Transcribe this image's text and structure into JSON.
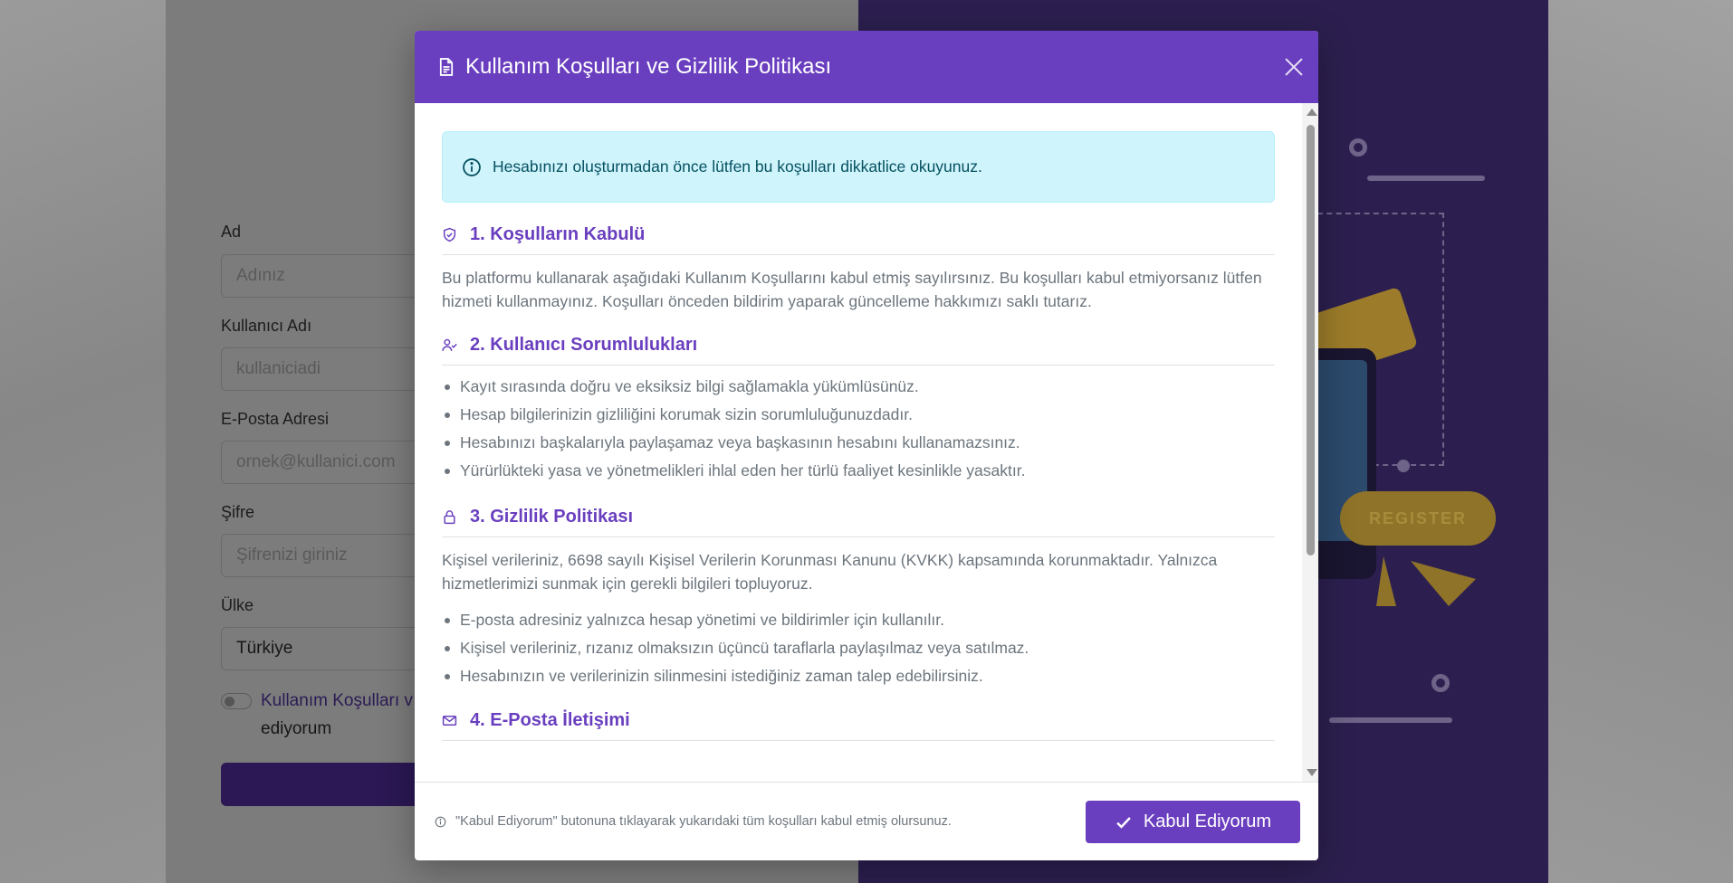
{
  "background": {
    "form": {
      "fields": [
        {
          "label": "Ad",
          "placeholder": "Adınız"
        },
        {
          "label": "Kullanıcı Adı",
          "placeholder": "kullaniciadi"
        },
        {
          "label": "E-Posta Adresi",
          "placeholder": "ornek@kullanici.com"
        },
        {
          "label": "Şifre",
          "placeholder": "Şifrenizi giriniz"
        },
        {
          "label": "Ülke",
          "value": "Türkiye"
        }
      ],
      "terms_link": "Kullanım Koşulları v",
      "terms_rest": "ediyorum"
    },
    "art": {
      "register_label": "REGISTER"
    }
  },
  "modal": {
    "title": "Kullanım Koşulları ve Gizlilik Politikası",
    "alert": "Hesabınızı oluşturmadan önce lütfen bu koşulları dikkatlice okuyunuz.",
    "sections": [
      {
        "title": "1. Koşulların Kabulü",
        "icon": "shield-check-icon",
        "paragraph": "Bu platformu kullanarak aşağıdaki Kullanım Koşullarını kabul etmiş sayılırsınız. Bu koşulları kabul etmiyorsanız lütfen hizmeti kullanmayınız. Koşulları önceden bildirim yaparak güncelleme hakkımızı saklı tutarız."
      },
      {
        "title": "2. Kullanıcı Sorumlulukları",
        "icon": "user-check-icon",
        "bullets": [
          "Kayıt sırasında doğru ve eksiksiz bilgi sağlamakla yükümlüsünüz.",
          "Hesap bilgilerinizin gizliliğini korumak sizin sorumluluğunuzdadır.",
          "Hesabınızı başkalarıyla paylaşamaz veya başkasının hesabını kullanamazsınız.",
          "Yürürlükteki yasa ve yönetmelikleri ihlal eden her türlü faaliyet kesinlikle yasaktır."
        ]
      },
      {
        "title": "3. Gizlilik Politikası",
        "icon": "lock-icon",
        "paragraph": "Kişisel verileriniz, 6698 sayılı Kişisel Verilerin Korunması Kanunu (KVKK) kapsamında korunmaktadır. Yalnızca hizmetlerimizi sunmak için gerekli bilgileri topluyoruz.",
        "bullets": [
          "E-posta adresiniz yalnızca hesap yönetimi ve bildirimler için kullanılır.",
          "Kişisel verileriniz, rızanız olmaksızın üçüncü taraflarla paylaşılmaz veya satılmaz.",
          "Hesabınızın ve verilerinizin silinmesini istediğiniz zaman talep edebilirsiniz."
        ]
      },
      {
        "title": "4. E-Posta İletişimi",
        "icon": "envelope-icon"
      }
    ],
    "footer_note": "\"Kabul Ediyorum\" butonuna tıklayarak yukarıdaki tüm koşulları kabul etmiş olursunuz.",
    "accept_label": "Kabul Ediyorum"
  },
  "colors": {
    "brand": "#6a3fbf",
    "alert_bg": "#cff4fc",
    "alert_text": "#055160",
    "muted_text": "#6c757d"
  }
}
